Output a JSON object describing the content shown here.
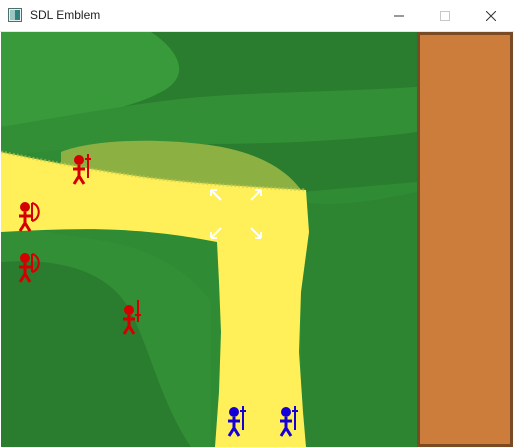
{
  "window": {
    "title": "SDL Emblem",
    "app_icon": "window-app-icon",
    "controls": [
      "minimize",
      "maximize",
      "close"
    ]
  },
  "colors": {
    "grass_dark": "#2b7f2f",
    "grass_mid": "#33923a",
    "grass_light": "#3f9f3a",
    "path_yellow": "#fff05a",
    "path_olive": "#8db043",
    "red_unit": "#d40000",
    "blue_unit": "#1400d6",
    "panel": "#cc7d3c",
    "panel_border": "#7a4a24",
    "cursor": "#ffffff"
  },
  "units": [
    {
      "team": "red",
      "weapon": "sword"
    },
    {
      "team": "red",
      "weapon": "bow"
    },
    {
      "team": "red",
      "weapon": "bow"
    },
    {
      "team": "red",
      "weapon": "sword"
    },
    {
      "team": "blue",
      "weapon": "sword"
    },
    {
      "team": "blue",
      "weapon": "sword"
    }
  ],
  "selection_cursor": {
    "icon": "selection-cursor-icon"
  }
}
